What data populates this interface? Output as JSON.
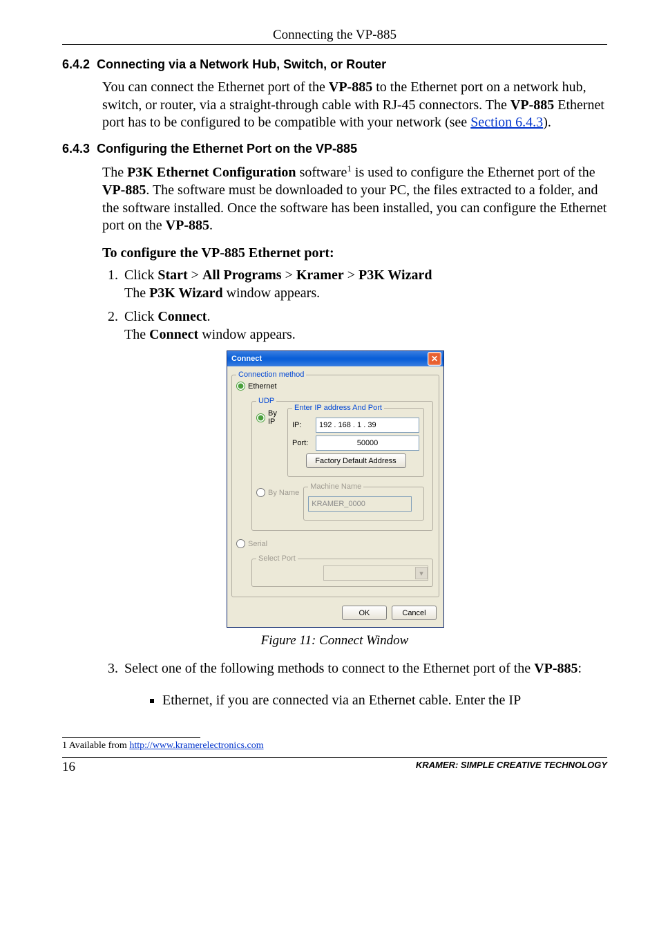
{
  "header": {
    "title": "Connecting the VP-885"
  },
  "s642": {
    "heading_num": "6.4.2",
    "heading_text": "Connecting via a Network Hub, Switch, or Router",
    "para_parts": {
      "a": "You can connect the Ethernet port of the ",
      "b": "VP-885",
      "c": " to the Ethernet port on a network hub, switch, or router, via a straight-through cable with RJ-45 connectors. The ",
      "d": "VP-885",
      "e": " Ethernet port has to be configured to be compatible with your network (see ",
      "link": "Section 6.4.3",
      "f": ")."
    }
  },
  "s643": {
    "heading_num": "6.4.3",
    "heading_text": "Configuring the Ethernet Port on the VP-885",
    "para1": {
      "a": "The ",
      "b": "P3K Ethernet Configuration",
      "c": " software",
      "sup": "1",
      "d": " is used to configure the Ethernet port of the ",
      "e": "VP-885",
      "f": ". The software must be downloaded to your PC, the files extracted to a folder, and the software installed. Once the software has been installed, you can configure the Ethernet port on the ",
      "g": "VP-885",
      "h": "."
    },
    "heading_proc": "To configure the VP-885 Ethernet port:",
    "step1": {
      "a": "Click ",
      "b": "Start",
      "gt1": " > ",
      "c": "All Programs",
      "gt2": " > ",
      "d": "Kramer",
      "gt3": " > ",
      "e": "P3K Wizard",
      "f": "The ",
      "g": "P3K Wizard",
      "h": " window appears."
    },
    "step2": {
      "a": "Click ",
      "b": "Connect",
      "c": ".",
      "d": "The ",
      "e": "Connect",
      "f": " window appears."
    },
    "step3": {
      "a": "Select one of the following methods to connect to the Ethernet port of the ",
      "b": "VP-885",
      "c": ":",
      "bullet": "Ethernet, if you are connected via an Ethernet cable. Enter the IP"
    },
    "fig_caption": "Figure 11: Connect Window"
  },
  "dialog": {
    "title": "Connect",
    "conn_method": "Connection method",
    "ethernet": "Ethernet",
    "udp": "UDP",
    "byip": "By IP",
    "enter_ip": "Enter IP address And Port",
    "ip_label": "IP:",
    "ip_value": "192 . 168 .   1   .   39",
    "port_label": "Port:",
    "port_value": "50000",
    "factory_btn": "Factory Default Address",
    "byname": "By Name",
    "machine_name": "Machine Name",
    "machine_value": "KRAMER_0000",
    "serial": "Serial",
    "select_port": "Select Port",
    "ok": "OK",
    "cancel": "Cancel"
  },
  "footnote": {
    "lead": "1 Available from ",
    "link": "http://www.kramerelectronics.com"
  },
  "footer": {
    "page": "16",
    "brand": "KRAMER:  SIMPLE CREATIVE TECHNOLOGY"
  }
}
